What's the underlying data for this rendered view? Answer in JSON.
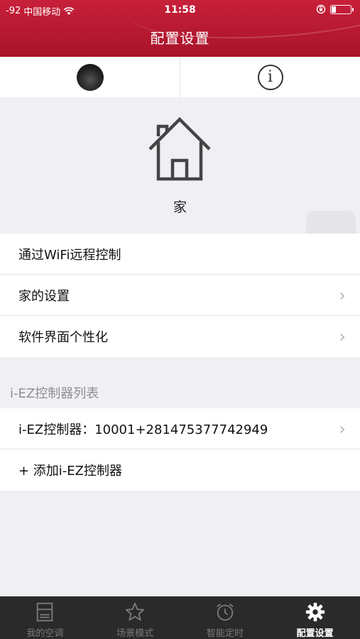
{
  "status": {
    "signal": "-92",
    "carrier": "中国移动",
    "time": "11:58"
  },
  "header": {
    "title": "配置设置"
  },
  "profile_row": {
    "avatar": "avatar-image",
    "info_icon": "info-icon"
  },
  "home": {
    "label": "家",
    "icon": "home-icon"
  },
  "settings_list": [
    {
      "label": "通过WiFi远程控制",
      "chevron": false
    },
    {
      "label": "家的设置",
      "chevron": true
    },
    {
      "label": "软件界面个性化",
      "chevron": true
    }
  ],
  "controller_section": {
    "header": "i-EZ控制器列表",
    "items": [
      {
        "label": "i-EZ控制器：10001+281475377742949",
        "chevron": true
      },
      {
        "label": "+ 添加i-EZ控制器",
        "chevron": false
      }
    ]
  },
  "chevron_glyph": "›",
  "tabbar": {
    "tabs": [
      {
        "label": "我的空调",
        "icon": "air-conditioner-icon",
        "active": false
      },
      {
        "label": "场景模式",
        "icon": "star-icon",
        "active": false
      },
      {
        "label": "智能定时",
        "icon": "alarm-clock-icon",
        "active": false
      },
      {
        "label": "配置设置",
        "icon": "gear-icon",
        "active": true
      }
    ]
  },
  "colors": {
    "header_red": "#b8182f",
    "tabbar_bg": "#2a2a2a",
    "page_bg": "#efeff4"
  }
}
